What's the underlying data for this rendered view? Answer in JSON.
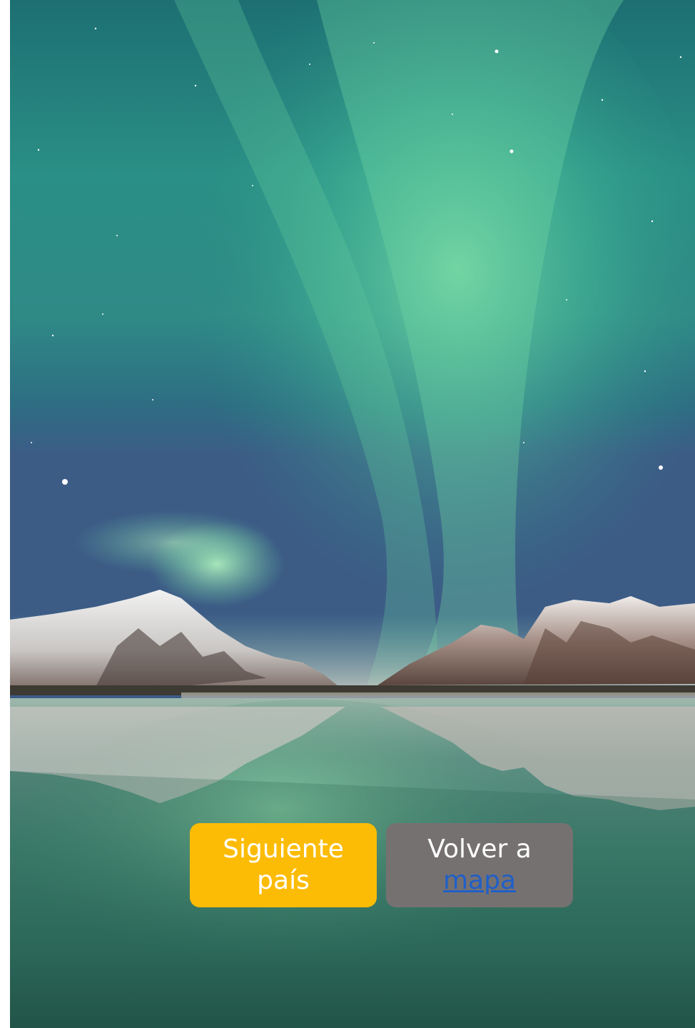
{
  "slide": {
    "background_image": "aurora-borealis-lake-mountains-photo"
  },
  "buttons": {
    "next": {
      "line1": "Siguiente",
      "line2": "país",
      "color": "#fcbc05"
    },
    "back": {
      "line1": "Volver a",
      "link_text": "mapa",
      "color": "#767171",
      "link_color": "#1f5fc8"
    }
  }
}
